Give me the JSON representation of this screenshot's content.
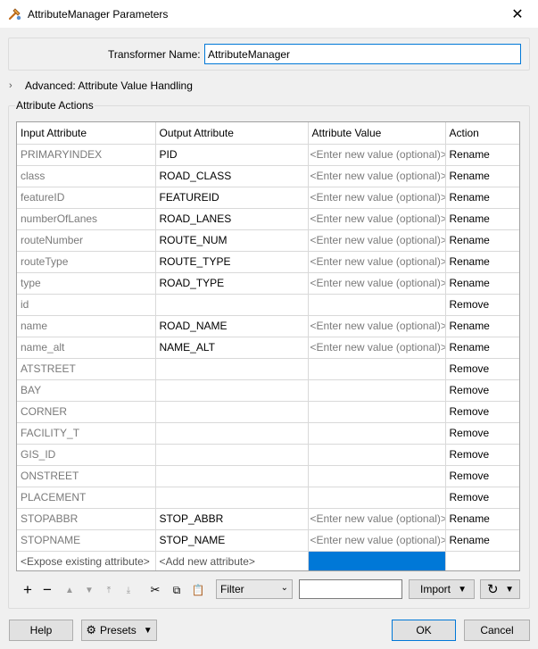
{
  "window": {
    "title": "AttributeManager Parameters"
  },
  "transformer": {
    "label": "Transformer Name:",
    "value": "AttributeManager"
  },
  "advanced": {
    "label": "Advanced: Attribute Value Handling"
  },
  "actions": {
    "group_title": "Attribute Actions",
    "columns": [
      "Input Attribute",
      "Output Attribute",
      "Attribute Value",
      "Action"
    ],
    "rows": [
      {
        "input": "PRIMARYINDEX",
        "output": "PID",
        "value": "<Enter new value (optional)>",
        "action": "Rename"
      },
      {
        "input": "class",
        "output": "ROAD_CLASS",
        "value": "<Enter new value (optional)>",
        "action": "Rename"
      },
      {
        "input": "featureID",
        "output": "FEATUREID",
        "value": "<Enter new value (optional)>",
        "action": "Rename"
      },
      {
        "input": "numberOfLanes",
        "output": "ROAD_LANES",
        "value": "<Enter new value (optional)>",
        "action": "Rename"
      },
      {
        "input": "routeNumber",
        "output": "ROUTE_NUM",
        "value": "<Enter new value (optional)>",
        "action": "Rename"
      },
      {
        "input": "routeType",
        "output": "ROUTE_TYPE",
        "value": "<Enter new value (optional)>",
        "action": "Rename"
      },
      {
        "input": "type",
        "output": "ROAD_TYPE",
        "value": "<Enter new value (optional)>",
        "action": "Rename"
      },
      {
        "input": "id",
        "output": "",
        "value": "",
        "action": "Remove"
      },
      {
        "input": "name",
        "output": "ROAD_NAME",
        "value": "<Enter new value (optional)>",
        "action": "Rename"
      },
      {
        "input": "name_alt",
        "output": "NAME_ALT",
        "value": "<Enter new value (optional)>",
        "action": "Rename"
      },
      {
        "input": "ATSTREET",
        "output": "",
        "value": "",
        "action": "Remove"
      },
      {
        "input": "BAY",
        "output": "",
        "value": "",
        "action": "Remove"
      },
      {
        "input": "CORNER",
        "output": "",
        "value": "",
        "action": "Remove"
      },
      {
        "input": "FACILITY_T",
        "output": "",
        "value": "",
        "action": "Remove"
      },
      {
        "input": "GIS_ID",
        "output": "",
        "value": "",
        "action": "Remove"
      },
      {
        "input": "ONSTREET",
        "output": "",
        "value": "",
        "action": "Remove"
      },
      {
        "input": "PLACEMENT",
        "output": "",
        "value": "",
        "action": "Remove"
      },
      {
        "input": "STOPABBR",
        "output": "STOP_ABBR",
        "value": "<Enter new value (optional)>",
        "action": "Rename"
      },
      {
        "input": "STOPNAME",
        "output": "STOP_NAME",
        "value": "<Enter new value (optional)>",
        "action": "Rename"
      }
    ],
    "new_row": {
      "input": "<Expose existing attribute>",
      "output": "<Add new attribute>"
    },
    "selection_color": "#0078d7"
  },
  "toolbar": {
    "filter_label": "Filter",
    "filter_value": "",
    "import_label": "Import",
    "icons": [
      "plus-icon",
      "minus-icon",
      "move-up-icon",
      "move-down-icon",
      "move-top-icon",
      "move-bottom-icon",
      "cut-icon",
      "copy-icon",
      "paste-icon",
      "refresh-icon"
    ]
  },
  "footer": {
    "help": "Help",
    "presets": "Presets",
    "ok": "OK",
    "cancel": "Cancel"
  }
}
